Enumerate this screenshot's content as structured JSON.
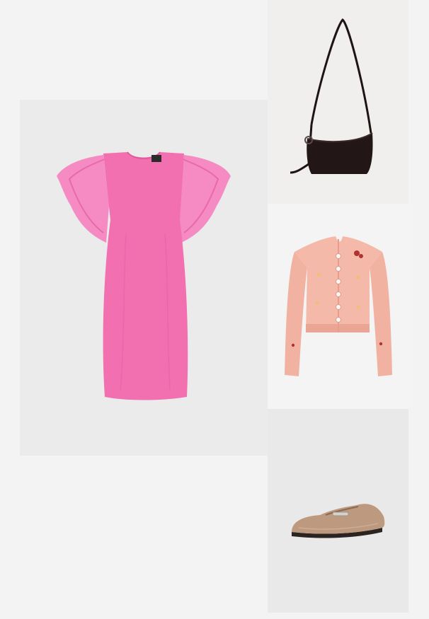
{
  "page": {
    "background": "#f3f3f3"
  },
  "outfit": {
    "items": [
      {
        "id": "dress",
        "icon": "pink-ruffle-sleeve-dress-image",
        "tile_color": "#ebebeb",
        "product_color": "#f26fb0"
      },
      {
        "id": "bag",
        "icon": "black-leather-shoulder-bag-image",
        "tile_color": "#f0efed",
        "product_color": "#1f1414"
      },
      {
        "id": "cardigan",
        "icon": "pink-embroidered-cardigan-image",
        "tile_color": "#f4f4f4",
        "product_color": "#f1b2a2"
      },
      {
        "id": "loafer",
        "icon": "beige-leather-loafer-image",
        "tile_color": "#e9e9e9",
        "product_color": "#b8957a"
      }
    ]
  }
}
